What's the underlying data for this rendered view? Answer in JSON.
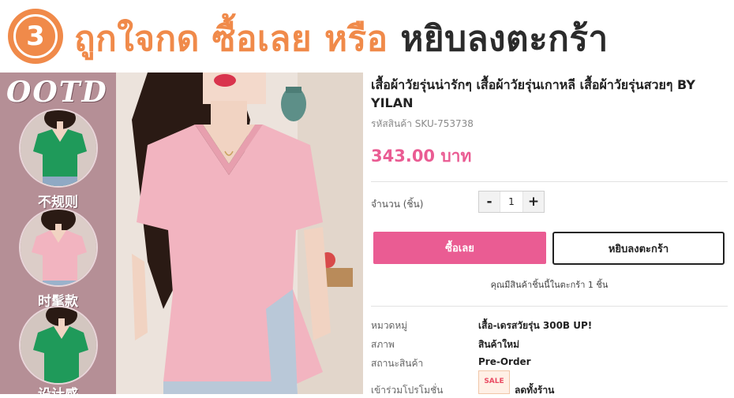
{
  "header": {
    "step_number": "3",
    "line_part1": "ถูกใจกด ",
    "line_part2": "ซื้อเลย หรือ ",
    "line_part3": "หยิบลงตะกร้า"
  },
  "gallery": {
    "ootd_text": "OOTD",
    "captions": [
      "不规则",
      "时髦款",
      "设计感"
    ]
  },
  "product": {
    "title": "เสื้อผ้าวัยรุ่นน่ารักๆ เสื้อผ้าวัยรุ่นเกาหลี เสื้อผ้าวัยรุ่นสวยๆ BY YILAN",
    "sku": "รหัสสินค้า SKU-753738",
    "price": "343.00 บาท",
    "quantity_label": "จำนวน (ชิ้น)",
    "quantity_minus": "-",
    "quantity_value": "1",
    "quantity_plus": "+",
    "buy_now_label": "ซื้อเลย",
    "add_to_cart_label": "หยิบลงตะกร้า",
    "cart_note": "คุณมีสินค้าชิ้นนี้ในตะกร้า 1 ชิ้น"
  },
  "details": {
    "category_label": "หมวดหมู่",
    "category_value": "เสื้อ-เดรสวัยรุ่น 300B UP!",
    "condition_label": "สภาพ",
    "condition_value": "สินค้าใหม่",
    "status_label": "สถานะสินค้า",
    "status_value": "Pre-Order",
    "promo_label": "เข้าร่วมโปรโมชั่น",
    "promo_badge": "SALE",
    "promo_value": "ลดทั้งร้าน"
  },
  "colors": {
    "accent_orange": "#f08a4a",
    "price_pink": "#ea5c93",
    "gallery_panel": "#b58f96",
    "shirt_green": "#1f9a5a",
    "shirt_pink": "#f2b4c0"
  }
}
